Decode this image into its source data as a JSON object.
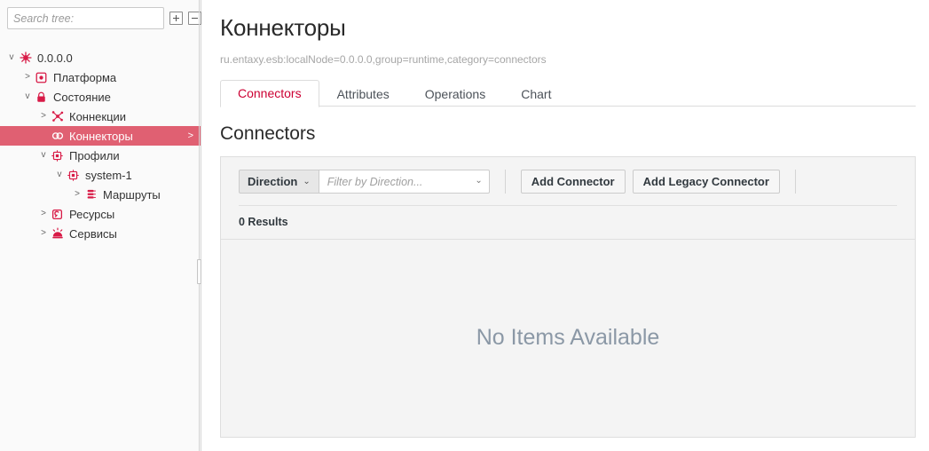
{
  "sidebar": {
    "search": {
      "placeholder": "Search tree:",
      "value": ""
    },
    "expand_all_label": "+",
    "collapse_all_label": "-",
    "tree": [
      {
        "label": "0.0.0.0",
        "caret": "v",
        "icon": "node-icon",
        "depth": 0,
        "selected": false
      },
      {
        "label": "Платформа",
        "caret": ">",
        "icon": "platform-icon",
        "depth": 1,
        "selected": false
      },
      {
        "label": "Состояние",
        "caret": "v",
        "icon": "state-icon",
        "depth": 1,
        "selected": false
      },
      {
        "label": "Коннекции",
        "caret": ">",
        "icon": "connections-icon",
        "depth": 2,
        "selected": false
      },
      {
        "label": "Коннекторы",
        "caret": "",
        "icon": "connectors-icon",
        "depth": 2,
        "selected": true,
        "row_arrow": ">"
      },
      {
        "label": "Профили",
        "caret": "v",
        "icon": "profiles-icon",
        "depth": 2,
        "selected": false
      },
      {
        "label": "system-1",
        "caret": "v",
        "icon": "profile-icon",
        "depth": 3,
        "selected": false
      },
      {
        "label": "Маршруты",
        "caret": ">",
        "icon": "routes-icon",
        "depth": 4,
        "selected": false
      },
      {
        "label": "Ресурсы",
        "caret": ">",
        "icon": "resources-icon",
        "depth": 2,
        "selected": false
      },
      {
        "label": "Сервисы",
        "caret": ">",
        "icon": "services-icon",
        "depth": 2,
        "selected": false
      }
    ]
  },
  "header": {
    "title": "Коннекторы",
    "subtitle": "ru.entaxy.esb:localNode=0.0.0.0,group=runtime,category=connectors"
  },
  "tabs": [
    {
      "label": "Connectors",
      "active": true
    },
    {
      "label": "Attributes",
      "active": false
    },
    {
      "label": "Operations",
      "active": false
    },
    {
      "label": "Chart",
      "active": false
    }
  ],
  "content": {
    "section_title": "Connectors",
    "toolbar": {
      "direction_label": "Direction",
      "direction_caret": "⌄",
      "filter_placeholder": "Filter by Direction...",
      "filter_value": "",
      "filter_caret": "⌄",
      "add_connector_label": "Add Connector",
      "add_legacy_connector_label": "Add Legacy Connector"
    },
    "results_count": "0 Results",
    "empty_state": "No Items Available"
  },
  "colors": {
    "accent": "#cc0033",
    "selected_row": "#e06072",
    "icon_red": "#d81b47",
    "muted_text": "#a6a6a6",
    "empty_text": "#8b98a6"
  }
}
